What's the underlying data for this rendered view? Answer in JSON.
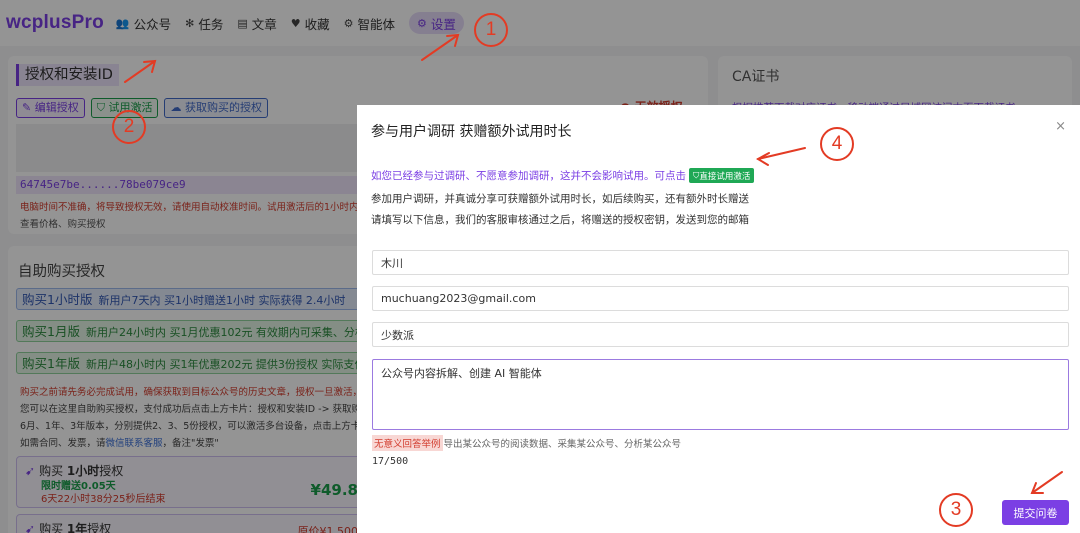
{
  "nav": {
    "brand": "wcplusPro",
    "items": [
      {
        "label": "公众号",
        "icon": "users-icon"
      },
      {
        "label": "任务",
        "icon": "bug-icon"
      },
      {
        "label": "文章",
        "icon": "article-icon"
      },
      {
        "label": "收藏",
        "icon": "heart-icon"
      },
      {
        "label": "智能体",
        "icon": "gear-icon"
      },
      {
        "label": "设置",
        "icon": "settings-icon"
      }
    ]
  },
  "auth": {
    "title": "授权和安装ID",
    "buttons": {
      "edit": "编辑授权",
      "trial": "试用激活",
      "fetch": "获取购买的授权"
    },
    "status": "无效授权",
    "id": "64745e7be......78be079ce9",
    "warning": "电脑时间不准确，将导致授权无效，请使用自动校准时间。试用激活后的1小时内，",
    "links": "查看价格、购买授权"
  },
  "ca": {
    "title": "CA证书",
    "desc": "根据推荐下载对应证书。移动端通过局域网访问本页下载证书"
  },
  "buy": {
    "title": "自助购买授权",
    "plans": [
      {
        "name": "购买1小时版",
        "desc": "新用户7天内 买1小时赠送1小时 实际获得 2.4小时"
      },
      {
        "name": "购买1月版",
        "desc": "新用户24小时内 买1月优惠102元 有效期内可采集、分析上"
      },
      {
        "name": "购买1年版",
        "desc": "新用户48小时内 买1年优惠202元 提供3份授权 实际支付 ¥"
      }
    ],
    "notes": {
      "line1": "购买之前请先务必完成试用，确保获取到目标公众号的历史文章，授权一旦激活，暂",
      "line2": "您可以在这里自助购买授权，支付成功后点击上方卡片：授权和安装ID -> 获取购买",
      "line3": "6月、1年、3年版本，分别提供2、3、5份授权，可以激活多台设备，点击上方卡片",
      "line4_prefix": "如需合同、发票，请",
      "line4_link": "微信联系客服",
      "line4_suffix": "，备注\"发票\""
    },
    "product1": {
      "name_prefix": "购买 ",
      "name_bold": "1小时",
      "name_suffix": "授权",
      "gift": "限时赠送0.05天",
      "timer": "6天22小时38分25秒后结束",
      "price": "¥49.8"
    },
    "product2": {
      "name_prefix": "购买 ",
      "name_bold": "1年",
      "name_suffix": "授权",
      "price": "原价¥1,500"
    }
  },
  "modal": {
    "title": "参与用户调研 获赠额外试用时长",
    "close": "×",
    "line1": "如您已经参与过调研、不愿意参加调研，这并不会影响试用。可点击",
    "line1_tag": "直接试用激活",
    "line2": "参加用户调研，并真诚分享可获赠额外试用时长，如后续购买，还有额外时长赠送",
    "line3": "请填写以下信息，我们的客服审核通过之后，将赠送的授权密钥，发送到您的邮箱",
    "fields": {
      "name": "木川",
      "email": "muchuang2023@gmail.com",
      "org": "少数派",
      "usage": "公众号内容拆解、创建 AI 智能体"
    },
    "hint_tag": "无意义回答举例",
    "hint_text": "导出某公众号的阅读数据、采集某公众号、分析某公众号",
    "counter": "17/500",
    "submit": "提交问卷"
  },
  "annotations": {
    "c1": "1",
    "c2": "2",
    "c3": "3",
    "c4": "4",
    "color": "#e33b24"
  },
  "colors": {
    "brand": "#7b3fe4",
    "green": "#1fa855",
    "red": "#d23b2d"
  }
}
